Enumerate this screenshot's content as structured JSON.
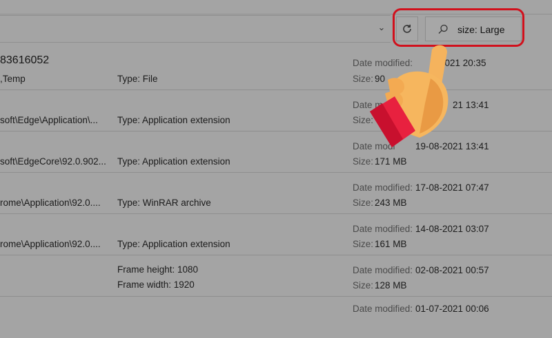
{
  "toolbar": {
    "search_value": "size: Large",
    "icons": {
      "refresh": "refresh-icon",
      "search": "search-icon",
      "chevron": "chevron-down-icon"
    }
  },
  "rows": [
    {
      "name": "83616052",
      "path": ",Temp",
      "mid": "Type: File",
      "date_label": "Date modified:",
      "date": "2-2021 20:35",
      "size_label": "Size:",
      "size": "90"
    },
    {
      "path": "soft\\Edge\\Application\\...",
      "mid": "Type: Application extension",
      "date_label": "Date m",
      "date": "21 13:41",
      "size_label": "Size:",
      "size": ""
    },
    {
      "path": "soft\\EdgeCore\\92.0.902...",
      "mid": "Type: Application extension",
      "date_label": "Date modi",
      "date": "19-08-2021 13:41",
      "size_label": "Size:",
      "size": "171 MB"
    },
    {
      "path": "rome\\Application\\92.0....",
      "mid": "Type: WinRAR archive",
      "date_label": "Date modified:",
      "date": "17-08-2021 07:47",
      "size_label": "Size:",
      "size": "243 MB"
    },
    {
      "path": "rome\\Application\\92.0....",
      "mid": "Type: Application extension",
      "date_label": "Date modified:",
      "date": "14-08-2021 03:07",
      "size_label": "Size:",
      "size": "161 MB"
    },
    {
      "path": "",
      "mid": "Frame height: 1080",
      "mid2": "Frame width: 1920",
      "date_label": "Date modified:",
      "date": "02-08-2021 00:57",
      "size_label": "Size:",
      "size": "128 MB"
    },
    {
      "date_label": "Date modified:",
      "date": "01-07-2021 00:06"
    }
  ],
  "colors": {
    "highlight": "#d1101c",
    "background": "#a4a4a4"
  }
}
